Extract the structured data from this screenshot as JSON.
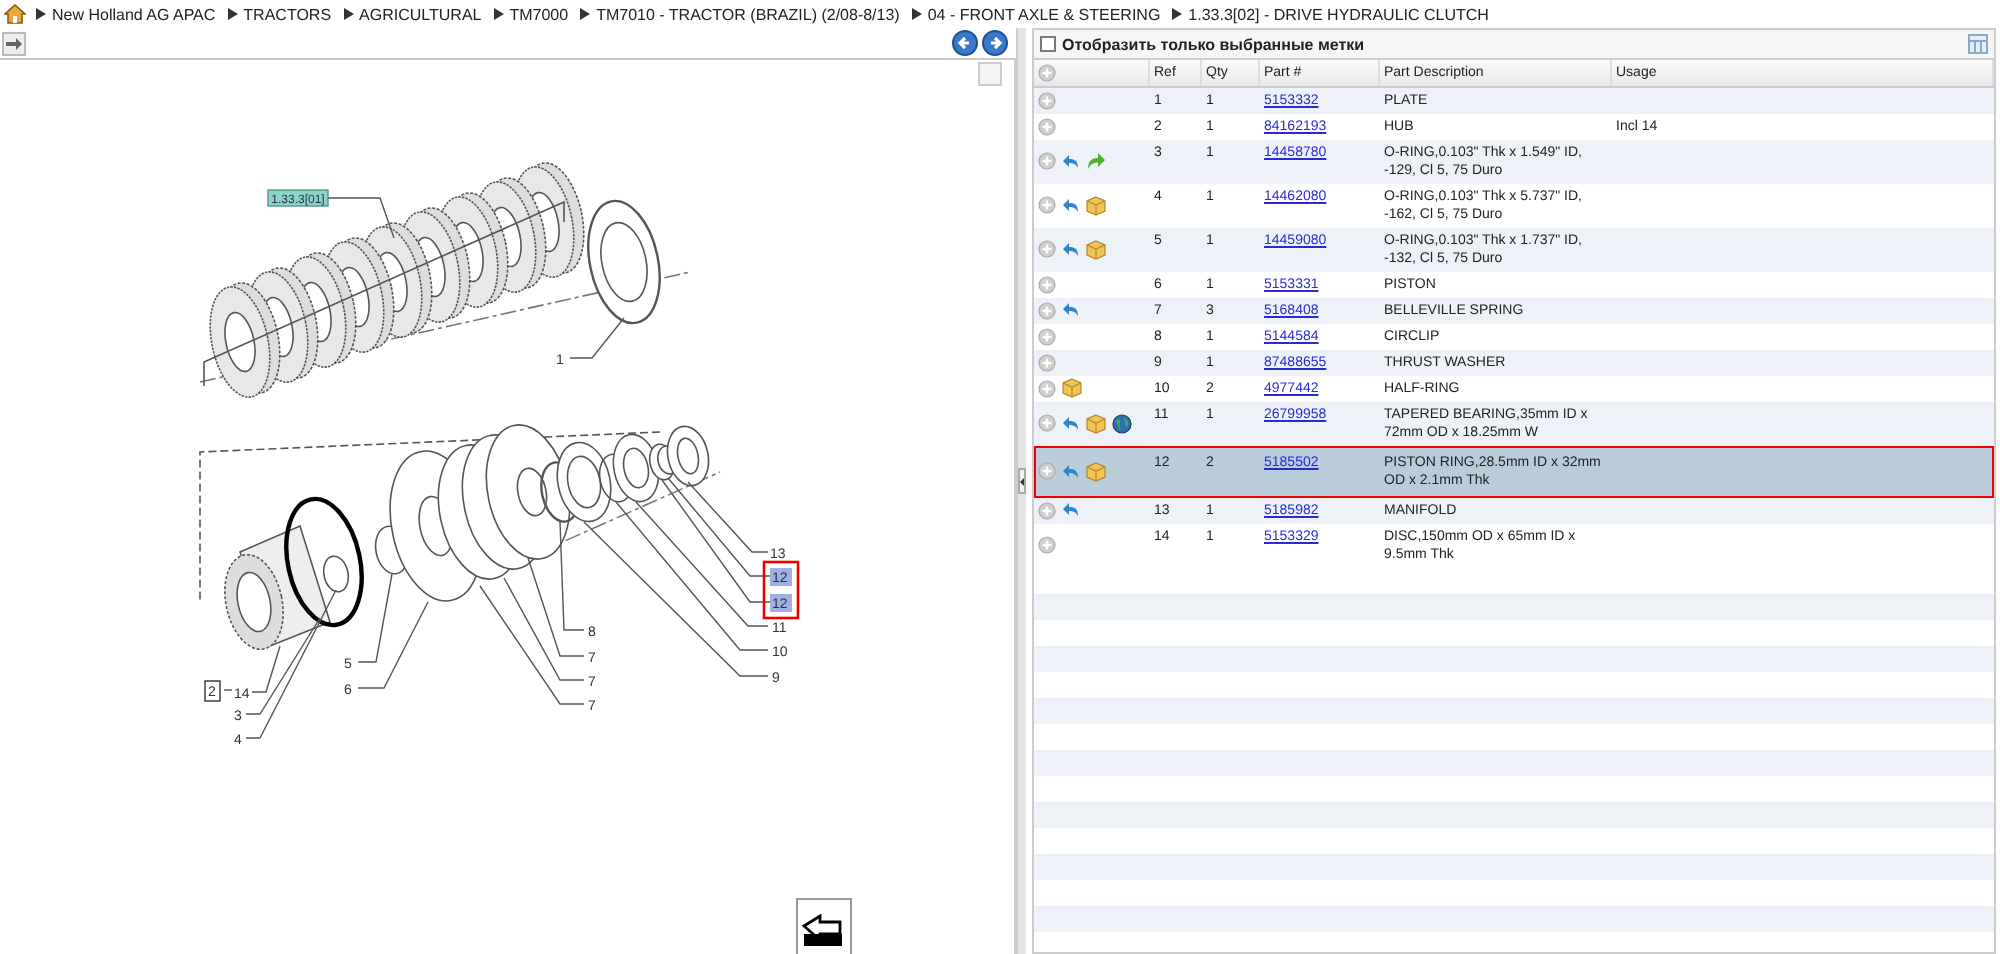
{
  "breadcrumb": [
    "New Holland AG APAC",
    "TRACTORS",
    "AGRICULTURAL",
    "TM7000",
    "TM7010 - TRACTOR (BRAZIL) (2/08-8/13)",
    "04 - FRONT AXLE & STEERING",
    "1.33.3[02] - DRIVE HYDRAULIC CLUTCH"
  ],
  "diagram": {
    "group_label": "1.33.3[01]",
    "callouts": [
      {
        "text": "1",
        "kind": "plain",
        "selected": false
      },
      {
        "text": "13",
        "kind": "plain",
        "selected": false
      },
      {
        "text": "12",
        "kind": "plain",
        "selected": true
      },
      {
        "text": "12",
        "kind": "plain",
        "selected": true
      },
      {
        "text": "11",
        "kind": "plain",
        "selected": false
      },
      {
        "text": "10",
        "kind": "plain",
        "selected": false
      },
      {
        "text": "9",
        "kind": "plain",
        "selected": false
      },
      {
        "text": "8",
        "kind": "plain",
        "selected": false
      },
      {
        "text": "7",
        "kind": "plain",
        "selected": false
      },
      {
        "text": "7",
        "kind": "plain",
        "selected": false
      },
      {
        "text": "7",
        "kind": "plain",
        "selected": false
      },
      {
        "text": "5",
        "kind": "plain",
        "selected": false
      },
      {
        "text": "2",
        "kind": "boxed",
        "selected": false
      },
      {
        "text": "14",
        "kind": "plain",
        "selected": false
      },
      {
        "text": "6",
        "kind": "plain",
        "selected": false
      },
      {
        "text": "3",
        "kind": "plain",
        "selected": false
      },
      {
        "text": "4",
        "kind": "plain",
        "selected": false
      }
    ]
  },
  "filter": {
    "label": "Отобразить только выбранные метки",
    "checked": false
  },
  "table": {
    "columns": [
      "Ref",
      "Qty",
      "Part #",
      "Part Description",
      "Usage"
    ],
    "rows": [
      {
        "ref": "1",
        "qty": "1",
        "part": "5153332",
        "description": "PLATE",
        "usage": "",
        "icons": [],
        "selected": false
      },
      {
        "ref": "2",
        "qty": "1",
        "part": "84162193",
        "description": "HUB",
        "usage": "Incl 14",
        "icons": [],
        "selected": false
      },
      {
        "ref": "3",
        "qty": "1",
        "part": "14458780",
        "description": "O-RING,0.103\" Thk x 1.549\" ID, -129, Cl 5, 75 Duro",
        "usage": "",
        "icons": [
          {
            "kind": "back"
          },
          {
            "kind": "forward"
          }
        ],
        "selected": false
      },
      {
        "ref": "4",
        "qty": "1",
        "part": "14462080",
        "description": "O-RING,0.103\" Thk x 5.737\" ID, -162, Cl 5, 75 Duro",
        "usage": "",
        "icons": [
          {
            "kind": "back"
          },
          {
            "kind": "box"
          }
        ],
        "selected": false
      },
      {
        "ref": "5",
        "qty": "1",
        "part": "14459080",
        "description": "O-RING,0.103\" Thk x 1.737\" ID, -132, Cl 5, 75 Duro",
        "usage": "",
        "icons": [
          {
            "kind": "back"
          },
          {
            "kind": "box"
          }
        ],
        "selected": false
      },
      {
        "ref": "6",
        "qty": "1",
        "part": "5153331",
        "description": "PISTON",
        "usage": "",
        "icons": [],
        "selected": false
      },
      {
        "ref": "7",
        "qty": "3",
        "part": "5168408",
        "description": "BELLEVILLE SPRING",
        "usage": "",
        "icons": [
          {
            "kind": "back"
          }
        ],
        "selected": false
      },
      {
        "ref": "8",
        "qty": "1",
        "part": "5144584",
        "description": "CIRCLIP",
        "usage": "",
        "icons": [],
        "selected": false
      },
      {
        "ref": "9",
        "qty": "1",
        "part": "87488655",
        "description": "THRUST WASHER",
        "usage": "",
        "icons": [],
        "selected": false
      },
      {
        "ref": "10",
        "qty": "2",
        "part": "4977442",
        "description": "HALF-RING",
        "usage": "",
        "icons": [
          {
            "kind": "box"
          }
        ],
        "selected": false
      },
      {
        "ref": "11",
        "qty": "1",
        "part": "26799958",
        "description": "TAPERED BEARING,35mm ID x 72mm OD x 18.25mm W",
        "usage": "",
        "icons": [
          {
            "kind": "back"
          },
          {
            "kind": "box"
          },
          {
            "kind": "globe"
          }
        ],
        "selected": false
      },
      {
        "ref": "12",
        "qty": "2",
        "part": "5185502",
        "description": "PISTON RING,28.5mm ID x 32mm OD x 2.1mm Thk",
        "usage": "",
        "icons": [
          {
            "kind": "back"
          },
          {
            "kind": "box"
          }
        ],
        "selected": true
      },
      {
        "ref": "13",
        "qty": "1",
        "part": "5185982",
        "description": "MANIFOLD",
        "usage": "",
        "icons": [
          {
            "kind": "back"
          }
        ],
        "selected": false
      },
      {
        "ref": "14",
        "qty": "1",
        "part": "5153329",
        "description": "DISC,150mm OD x 65mm ID x 9.5mm Thk",
        "usage": "",
        "icons": [],
        "selected": false
      }
    ]
  }
}
